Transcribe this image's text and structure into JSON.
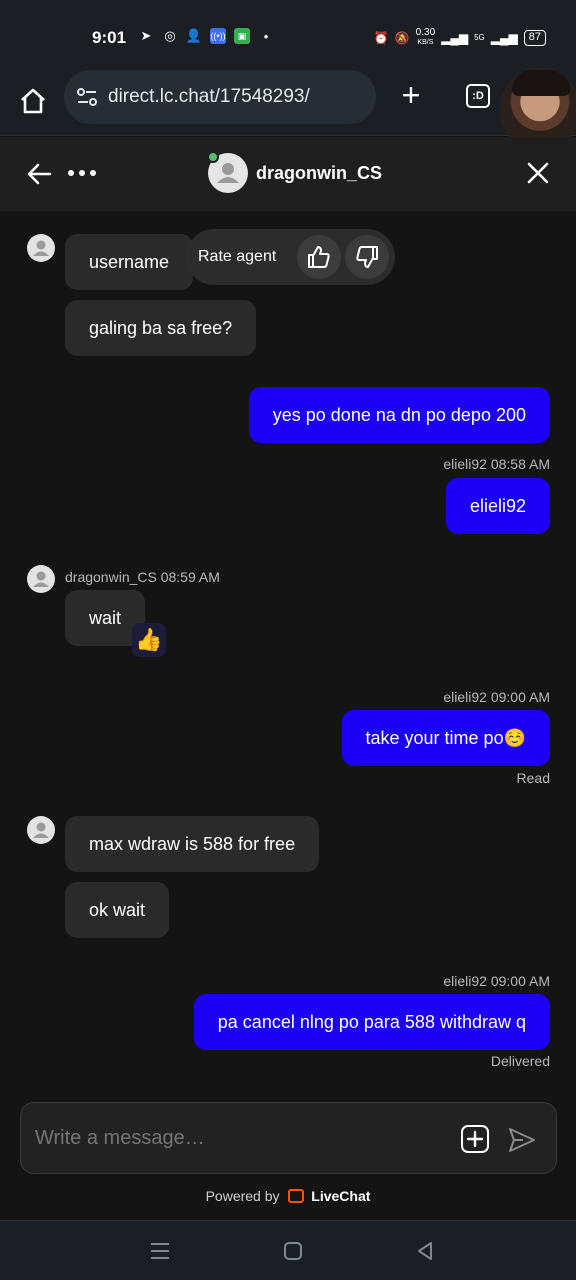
{
  "status_bar": {
    "time": "9:01",
    "net_speed": "0.30",
    "net_unit": "KB/S",
    "network": "5G",
    "battery": "87"
  },
  "browser": {
    "url": "direct.lc.chat/17548293/",
    "tabs_label": ":D"
  },
  "header": {
    "agent_name": "dragonwin_CS"
  },
  "rate": {
    "label": "Rate agent"
  },
  "messages": [
    {
      "side": "agent",
      "text": "username"
    },
    {
      "side": "agent",
      "text": "galing ba sa free?"
    },
    {
      "side": "user",
      "text": "yes po done na dn po depo 200"
    },
    {
      "side": "meta",
      "text": "elieli92 08:58 AM"
    },
    {
      "side": "user",
      "text": "elieli92"
    },
    {
      "side": "meta",
      "text": "dragonwin_CS 08:59 AM"
    },
    {
      "side": "agent",
      "text": "wait",
      "reaction": "👍"
    },
    {
      "side": "meta",
      "text": "elieli92 09:00 AM"
    },
    {
      "side": "user",
      "text": "take your time po☺️"
    },
    {
      "side": "meta",
      "text": "Read"
    },
    {
      "side": "agent",
      "text": "max wdraw is 588 for free"
    },
    {
      "side": "agent",
      "text": "ok wait"
    },
    {
      "side": "meta",
      "text": "elieli92 09:00 AM"
    },
    {
      "side": "user",
      "text": "pa cancel nlng po para 588 withdraw q"
    },
    {
      "side": "meta",
      "text": "Delivered"
    }
  ],
  "composer": {
    "placeholder": "Write a message…"
  },
  "footer": {
    "powered_by": "Powered by",
    "brand": "LiveChat"
  },
  "icons": {
    "brand_color": "#ff5100",
    "user_bubble": "#1c00f6",
    "online": "#4ec26c"
  }
}
